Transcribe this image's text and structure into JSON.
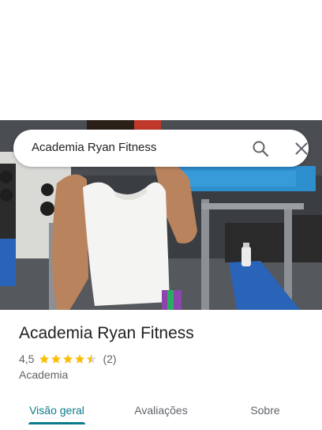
{
  "search": {
    "query": "Academia Ryan Fitness",
    "search_icon": "search-icon",
    "close_icon": "close-icon"
  },
  "place": {
    "name": "Academia Ryan Fitness",
    "rating": "4,5",
    "rating_stars": 4.5,
    "review_count": "(2)",
    "category": "Academia"
  },
  "tabs": [
    {
      "label": "Visão geral",
      "active": true
    },
    {
      "label": "Avaliações",
      "active": false
    },
    {
      "label": "Sobre",
      "active": false
    }
  ],
  "colors": {
    "accent": "#0b7a8a",
    "star": "#fbbc04",
    "text_primary": "#202124",
    "text_secondary": "#5f6368"
  }
}
